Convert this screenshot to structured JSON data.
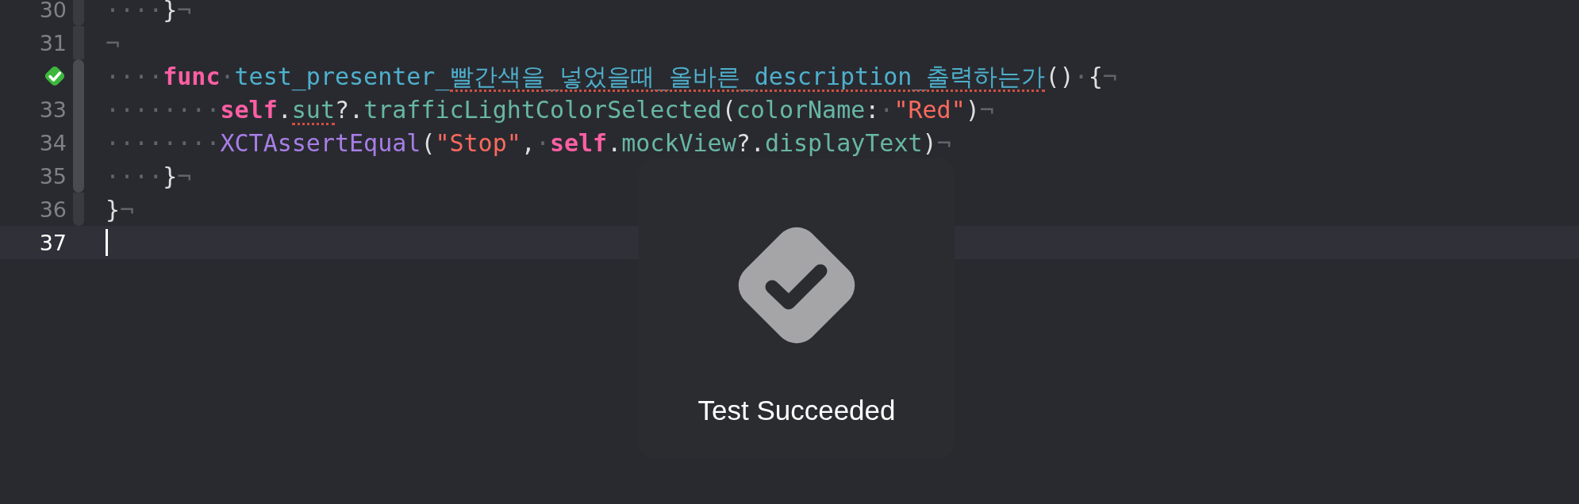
{
  "editor": {
    "lines": [
      {
        "number": "30",
        "current": false,
        "tokens": [
          {
            "kind": "ws",
            "text": "····"
          },
          {
            "kind": "plain",
            "text": "}"
          },
          {
            "kind": "ws",
            "text": "¬"
          }
        ]
      },
      {
        "number": "31",
        "current": false,
        "tokens": [
          {
            "kind": "ws",
            "text": "¬"
          }
        ]
      },
      {
        "test_passed": true,
        "current": false,
        "tokens": [
          {
            "kind": "ws",
            "text": "····"
          },
          {
            "kind": "keyword",
            "text": "func"
          },
          {
            "kind": "ws",
            "text": "·"
          },
          {
            "kind": "decl",
            "text": "test_presenter_"
          },
          {
            "kind": "decl",
            "text": "빨간색을_넣었을때_올바른_description_출력하는가",
            "misspelled": true
          },
          {
            "kind": "plain",
            "text": "()"
          },
          {
            "kind": "ws",
            "text": "·"
          },
          {
            "kind": "plain",
            "text": "{"
          },
          {
            "kind": "ws",
            "text": "¬"
          }
        ]
      },
      {
        "number": "33",
        "current": false,
        "tokens": [
          {
            "kind": "ws",
            "text": "········"
          },
          {
            "kind": "keyword",
            "text": "self"
          },
          {
            "kind": "plain",
            "text": "."
          },
          {
            "kind": "member",
            "text": "sut",
            "misspelled": true
          },
          {
            "kind": "plain",
            "text": "?."
          },
          {
            "kind": "member",
            "text": "trafficLightColorSelected"
          },
          {
            "kind": "plain",
            "text": "("
          },
          {
            "kind": "member",
            "text": "colorName"
          },
          {
            "kind": "plain",
            "text": ":"
          },
          {
            "kind": "ws",
            "text": "·"
          },
          {
            "kind": "string",
            "text": "\"Red\""
          },
          {
            "kind": "plain",
            "text": ")"
          },
          {
            "kind": "ws",
            "text": "¬"
          }
        ]
      },
      {
        "number": "34",
        "current": false,
        "tokens": [
          {
            "kind": "ws",
            "text": "········"
          },
          {
            "kind": "type",
            "text": "XCTAssertEqual"
          },
          {
            "kind": "plain",
            "text": "("
          },
          {
            "kind": "string",
            "text": "\"Stop\""
          },
          {
            "kind": "plain",
            "text": ","
          },
          {
            "kind": "ws",
            "text": "·"
          },
          {
            "kind": "keyword",
            "text": "self"
          },
          {
            "kind": "plain",
            "text": "."
          },
          {
            "kind": "member",
            "text": "mockView"
          },
          {
            "kind": "plain",
            "text": "?."
          },
          {
            "kind": "member",
            "text": "displayText"
          },
          {
            "kind": "plain",
            "text": ")"
          },
          {
            "kind": "ws",
            "text": "¬"
          }
        ]
      },
      {
        "number": "35",
        "current": false,
        "tokens": [
          {
            "kind": "ws",
            "text": "····"
          },
          {
            "kind": "plain",
            "text": "}"
          },
          {
            "kind": "ws",
            "text": "¬"
          }
        ]
      },
      {
        "number": "36",
        "current": false,
        "tokens": [
          {
            "kind": "plain",
            "text": "}"
          },
          {
            "kind": "ws",
            "text": "¬"
          }
        ]
      },
      {
        "number": "37",
        "current": true,
        "cursor": true
      }
    ]
  },
  "hud": {
    "message": "Test Succeeded"
  }
}
